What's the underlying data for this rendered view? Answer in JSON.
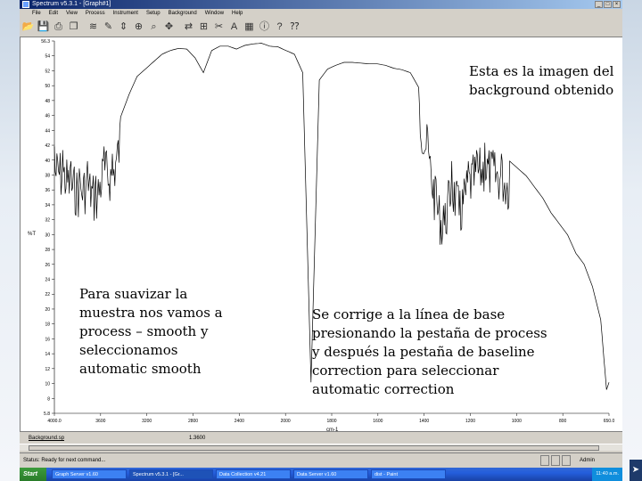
{
  "window": {
    "title": "Spectrum v5.3.1 - [Graph#1]",
    "controls": [
      "_",
      "□",
      "×"
    ]
  },
  "menu": [
    "File",
    "Edit",
    "View",
    "Process",
    "Instrument",
    "Setup",
    "Background",
    "Window",
    "Help"
  ],
  "toolbar_icons": [
    "open-icon",
    "save-icon",
    "print-icon",
    "copy-icon",
    "overlay-icon",
    "label-icon",
    "scale-icon",
    "zoom-icon",
    "search-icon",
    "move-icon",
    "compare-icon",
    "sample-icon",
    "cut-icon",
    "text-icon",
    "grid-icon",
    "info-icon",
    "help-icon",
    "context-help-icon"
  ],
  "plot": {
    "axis_unit": "%T",
    "x_label": "cm-1",
    "background_tab": "Background.sp",
    "background_value": "1.3600"
  },
  "chart_data": {
    "type": "line",
    "xlabel": "cm-1",
    "ylabel": "%T",
    "xlim": [
      4000,
      650
    ],
    "ylim": [
      5.8,
      56.3
    ],
    "x_ticks": [
      "4000.0",
      "3600",
      "3200",
      "2800",
      "2400",
      "2000",
      "1800",
      "1600",
      "1400",
      "1200",
      "1000",
      "800",
      "650.0"
    ],
    "y_ticks": [
      "56.3",
      "54",
      "52",
      "50",
      "48",
      "46",
      "44",
      "42",
      "40",
      "38",
      "36",
      "34",
      "32",
      "30",
      "28",
      "26",
      "24",
      "22",
      "20",
      "18",
      "16",
      "14",
      "12",
      "10",
      "8",
      "5.8"
    ],
    "x": [
      4000,
      3950,
      3900,
      3850,
      3800,
      3750,
      3700,
      3650,
      3600,
      3550,
      3500,
      3450,
      3400,
      3350,
      3300,
      3250,
      3200,
      3150,
      3100,
      3050,
      3000,
      2950,
      2900,
      2850,
      2800,
      2750,
      2700,
      2650,
      2600,
      2550,
      2500,
      2450,
      2400,
      2350,
      2300,
      2250,
      2200,
      2150,
      2100,
      2050,
      2000,
      1950,
      1900,
      1850,
      1800,
      1750,
      1700,
      1650,
      1600,
      1550,
      1500,
      1450,
      1400,
      1350,
      1300,
      1250,
      1200,
      1150,
      1100,
      1050,
      1000,
      950,
      900,
      850,
      800,
      750,
      700,
      680,
      665,
      650
    ],
    "y": [
      42,
      41.5,
      40,
      39,
      40,
      38,
      42,
      41,
      46,
      49,
      51.5,
      52.5,
      53.5,
      54.5,
      55,
      55.3,
      55.2,
      54,
      52,
      55,
      55.6,
      55.6,
      55.2,
      55.7,
      55.9,
      56,
      55.6,
      55.5,
      55,
      54.5,
      52,
      10,
      51,
      52.5,
      53,
      53.4,
      53.4,
      53.3,
      53.2,
      53.2,
      53,
      52.6,
      52.4,
      52,
      50,
      45,
      38,
      34,
      40,
      36,
      40,
      41.5,
      42.5,
      41.5,
      41,
      40,
      39,
      38,
      36.5,
      35,
      33,
      31.5,
      30,
      27.5,
      26,
      23,
      18.5,
      13,
      9,
      10
    ]
  },
  "annotations": {
    "top_right": "Esta es la imagen del background obtenido",
    "left": "Para suavizar la muestra nos vamos a process – smooth y seleccionamos automatic smooth",
    "middle": "Se corrige a la línea de base presionando la pestaña de process y después la pestaña de baseline correction para seleccionar automatic correction"
  },
  "status": {
    "text": "Status: Ready for next command...",
    "user": "Admin"
  },
  "taskbar": {
    "start": "Start",
    "items": [
      "Graph Server v1.60",
      "Spectrum v5.3.1 - [Gr...",
      "Data Collection v4.21",
      "Data Server v1.60",
      "dist - Paint"
    ],
    "clock": "11:40 a.m."
  },
  "nav": "➤"
}
